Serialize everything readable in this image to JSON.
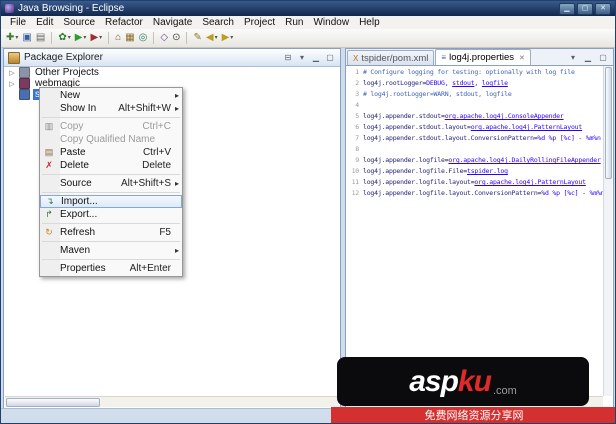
{
  "window": {
    "title": "Java Browsing - Eclipse"
  },
  "menu_bar": [
    "File",
    "Edit",
    "Source",
    "Refactor",
    "Navigate",
    "Search",
    "Project",
    "Run",
    "Window",
    "Help"
  ],
  "toolbar": [
    {
      "name": "new-wizard-icon",
      "glyph": "✚",
      "color": "#3c7d2f",
      "dropdown": true
    },
    {
      "name": "save-icon",
      "glyph": "▣",
      "color": "#3a5fa0"
    },
    {
      "name": "print-icon",
      "glyph": "▤",
      "color": "#666666"
    },
    {
      "sep": true
    },
    {
      "name": "debug-icon",
      "glyph": "✿",
      "color": "#2f7d2f",
      "dropdown": true
    },
    {
      "name": "run-icon",
      "glyph": "▶",
      "color": "#2f9d2f",
      "dropdown": true
    },
    {
      "name": "external-tools-icon",
      "glyph": "▶",
      "color": "#a03030",
      "dropdown": true
    },
    {
      "sep": true
    },
    {
      "name": "new-java-project-icon",
      "glyph": "⌂",
      "color": "#7a5a2f"
    },
    {
      "name": "new-package-icon",
      "glyph": "▦",
      "color": "#8a6a2a"
    },
    {
      "name": "new-class-icon",
      "glyph": "◎",
      "color": "#2f7d5f"
    },
    {
      "sep": true
    },
    {
      "name": "open-type-icon",
      "glyph": "◇",
      "color": "#6a4a9a"
    },
    {
      "name": "search-icon",
      "glyph": "⊙",
      "color": "#444444"
    },
    {
      "sep": true
    },
    {
      "name": "last-edit-icon",
      "glyph": "✎",
      "color": "#8a7a2a"
    },
    {
      "name": "back-icon",
      "glyph": "◀",
      "color": "#b8a020",
      "dropdown": true
    },
    {
      "name": "forward-icon",
      "glyph": "▶",
      "color": "#b8a020",
      "dropdown": true
    }
  ],
  "package_explorer": {
    "title": "Package Explorer",
    "header_icons": [
      {
        "name": "collapse-all-icon",
        "glyph": "⊟"
      },
      {
        "name": "view-menu-icon",
        "glyph": "▾"
      },
      {
        "name": "minimize-icon",
        "glyph": "▁"
      },
      {
        "name": "maximize-icon",
        "glyph": "▢"
      }
    ],
    "tree": [
      {
        "label": "Other Projects",
        "icon": "working-set-icon",
        "color": "#8a93a8",
        "arrow": true,
        "selected": false
      },
      {
        "label": "webmagic",
        "icon": "project-icon",
        "color": "#7a3b5f",
        "arrow": true,
        "selected": false
      },
      {
        "label": "sl4j",
        "icon": "project-icon",
        "color": "#4a6fae",
        "arrow": false,
        "selected": true
      }
    ]
  },
  "context_menu": {
    "items": [
      {
        "label": "New",
        "submenu": true
      },
      {
        "label": "Show In",
        "accel": "Alt+Shift+W",
        "submenu": true
      },
      {
        "sep": true
      },
      {
        "label": "Copy",
        "accel": "Ctrl+C",
        "icon": "copy-icon",
        "glyph": "▥",
        "iconColor": "#888888",
        "disabled": true
      },
      {
        "label": "Copy Qualified Name",
        "disabled": true
      },
      {
        "label": "Paste",
        "accel": "Ctrl+V",
        "icon": "paste-icon",
        "glyph": "▤",
        "iconColor": "#8a6a3a"
      },
      {
        "label": "Delete",
        "accel": "Delete",
        "icon": "delete-icon",
        "glyph": "✗",
        "iconColor": "#c03030"
      },
      {
        "sep": true
      },
      {
        "label": "Source",
        "accel": "Alt+Shift+S",
        "submenu": true
      },
      {
        "sep": true
      },
      {
        "label": "Import...",
        "icon": "import-icon",
        "glyph": "↴",
        "iconColor": "#3a7a3a",
        "highlight": true
      },
      {
        "label": "Export...",
        "icon": "export-icon",
        "glyph": "↱",
        "iconColor": "#3a7a3a"
      },
      {
        "sep": true
      },
      {
        "label": "Refresh",
        "accel": "F5",
        "icon": "refresh-icon",
        "glyph": "↻",
        "iconColor": "#c08a20"
      },
      {
        "sep": true
      },
      {
        "label": "Maven",
        "submenu": true
      },
      {
        "sep": true
      },
      {
        "label": "Properties",
        "accel": "Alt+Enter"
      }
    ]
  },
  "editor": {
    "tabs": [
      {
        "label": "tspider/pom.xml",
        "icon": "xml-file-icon",
        "glyph": "X",
        "color": "#c06a10",
        "active": false
      },
      {
        "label": "log4j.properties",
        "icon": "properties-file-icon",
        "glyph": "≡",
        "color": "#3a5fa0",
        "active": true
      }
    ],
    "tab_icons": [
      {
        "name": "tab-list-icon",
        "glyph": "▾"
      },
      {
        "name": "minimize-icon",
        "glyph": "▁"
      },
      {
        "name": "maximize-icon",
        "glyph": "▢"
      }
    ],
    "lines": [
      {
        "n": "1",
        "segs": [
          {
            "t": "# Configure logging for testing: optionally with log file",
            "c": "comment"
          }
        ]
      },
      {
        "n": "2",
        "segs": [
          {
            "t": "log4j.rootLogger",
            "c": "key"
          },
          {
            "t": "=",
            "c": "op"
          },
          {
            "t": "DEBUG, ",
            "c": "value"
          },
          {
            "t": "stdout",
            "c": "valueu"
          },
          {
            "t": ", ",
            "c": "value"
          },
          {
            "t": "logfile",
            "c": "valueu"
          }
        ]
      },
      {
        "n": "3",
        "segs": [
          {
            "t": "# log4j.rootLogger=WARN, stdout, logfile",
            "c": "comment"
          }
        ]
      },
      {
        "n": "4",
        "segs": []
      },
      {
        "n": "5",
        "segs": [
          {
            "t": "log4j.appender.stdout",
            "c": "key"
          },
          {
            "t": "=",
            "c": "op"
          },
          {
            "t": "org.apache.log4j.ConsoleAppender",
            "c": "valueu"
          }
        ]
      },
      {
        "n": "6",
        "segs": [
          {
            "t": "log4j.appender.stdout.layout",
            "c": "key"
          },
          {
            "t": "=",
            "c": "op"
          },
          {
            "t": "org.apache.log4j.PatternLayout",
            "c": "valueu"
          }
        ]
      },
      {
        "n": "7",
        "segs": [
          {
            "t": "log4j.appender.stdout.layout.ConversionPattern",
            "c": "key"
          },
          {
            "t": "=",
            "c": "op"
          },
          {
            "t": "%d %p [%c] - %m%n",
            "c": "value"
          }
        ]
      },
      {
        "n": "8",
        "segs": []
      },
      {
        "n": "9",
        "segs": [
          {
            "t": "log4j.appender.logfile",
            "c": "key"
          },
          {
            "t": "=",
            "c": "op"
          },
          {
            "t": "org.apache.log4j.DailyRollingFileAppender",
            "c": "valueu"
          }
        ]
      },
      {
        "n": "10",
        "segs": [
          {
            "t": "log4j.appender.logfile.File",
            "c": "key"
          },
          {
            "t": "=",
            "c": "op"
          },
          {
            "t": "tspider.log",
            "c": "valueu"
          }
        ]
      },
      {
        "n": "11",
        "segs": [
          {
            "t": "log4j.appender.logfile.layout",
            "c": "key"
          },
          {
            "t": "=",
            "c": "op"
          },
          {
            "t": "org.apache.log4j.PatternLayout",
            "c": "valueu"
          }
        ]
      },
      {
        "n": "12",
        "segs": [
          {
            "t": "log4j.appender.logfile.layout.ConversionPattern",
            "c": "key"
          },
          {
            "t": "=",
            "c": "op"
          },
          {
            "t": "%d %p [%c] - %m%n",
            "c": "value"
          }
        ]
      }
    ]
  },
  "watermark": {
    "logo_a": "asp",
    "logo_b": "ku",
    "logo_c": ".com",
    "banner": "免费网络资源分享网"
  }
}
